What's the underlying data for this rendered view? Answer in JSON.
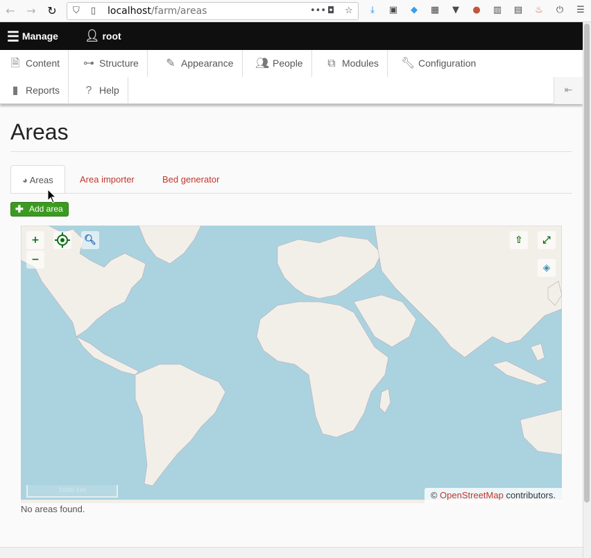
{
  "browser": {
    "url_host": "localhost",
    "url_path": "/farm/areas"
  },
  "toolbar": {
    "manage_label": "Manage",
    "user_label": "root"
  },
  "tray": {
    "items": [
      {
        "label": "Content",
        "icon": "file-icon"
      },
      {
        "label": "Structure",
        "icon": "sitemap-icon"
      },
      {
        "label": "Appearance",
        "icon": "brush-icon"
      },
      {
        "label": "People",
        "icon": "people-icon"
      },
      {
        "label": "Modules",
        "icon": "puzzle-icon"
      },
      {
        "label": "Configuration",
        "icon": "wrench-icon"
      },
      {
        "label": "Reports",
        "icon": "bar-chart-icon"
      },
      {
        "label": "Help",
        "icon": "help-icon"
      }
    ]
  },
  "page": {
    "title": "Areas",
    "tabs": [
      {
        "label": "Areas",
        "active": true
      },
      {
        "label": "Area importer",
        "active": false
      },
      {
        "label": "Bed generator",
        "active": false
      }
    ],
    "add_button": "Add area",
    "empty_message": "No areas found."
  },
  "map": {
    "zoom_in": "+",
    "zoom_out": "−",
    "scale_label": "5000 km",
    "attribution_prefix": "©",
    "attribution_link": "OpenStreetMap",
    "attribution_suffix": "contributors."
  },
  "colors": {
    "accent_green": "#3c9a21",
    "link_red": "#c1362a",
    "ocean": "#aad3df",
    "land": "#f2efe9"
  }
}
